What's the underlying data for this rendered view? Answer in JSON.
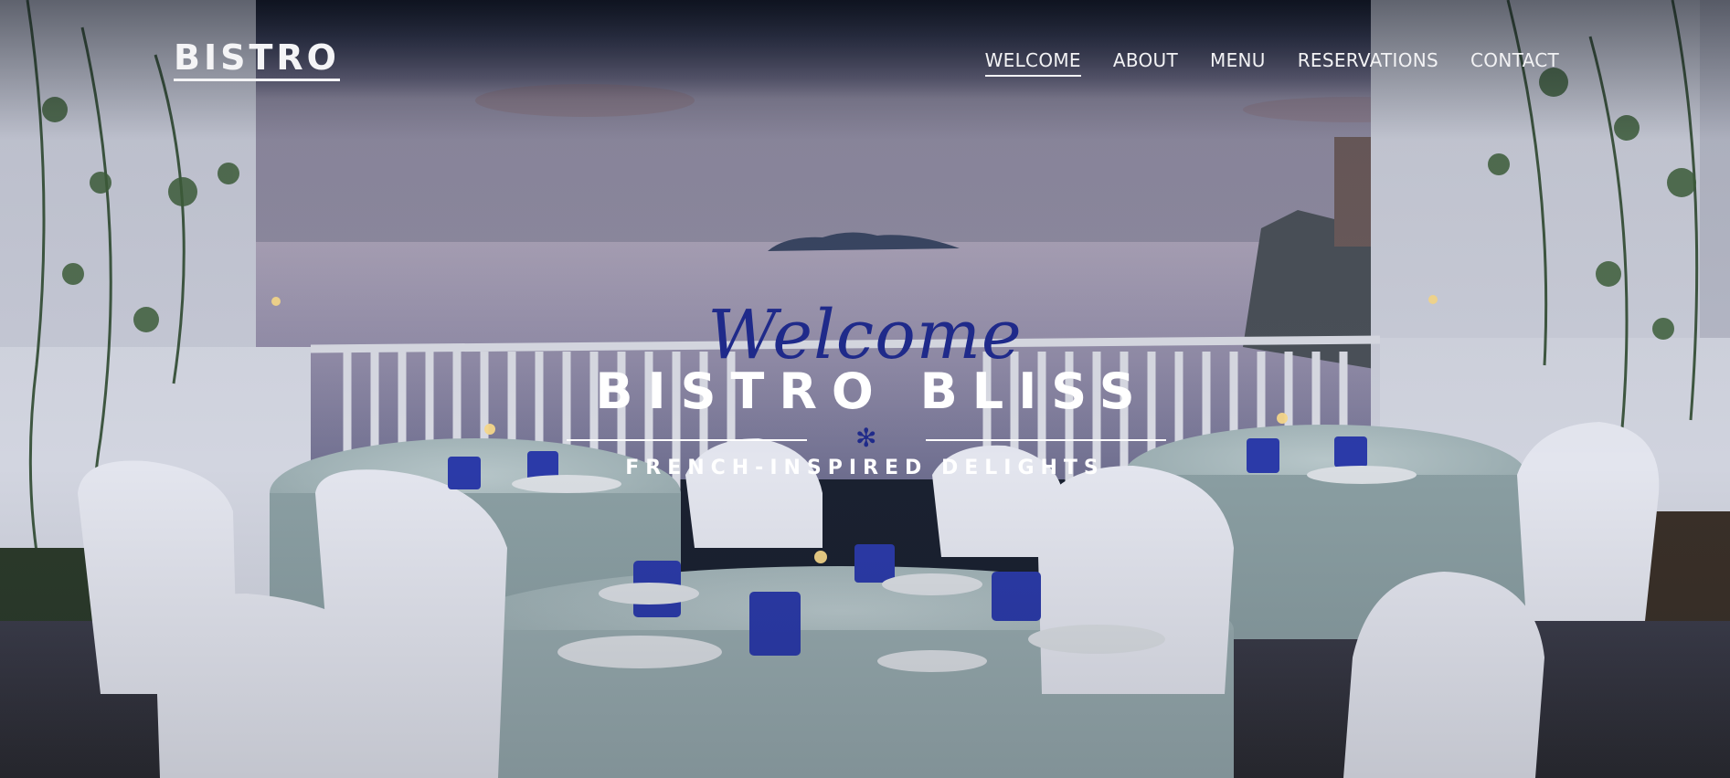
{
  "brand": {
    "logo": "BISTRO"
  },
  "nav": {
    "items": [
      {
        "label": "WELCOME",
        "active": true
      },
      {
        "label": "ABOUT",
        "active": false
      },
      {
        "label": "MENU",
        "active": false
      },
      {
        "label": "RESERVATIONS",
        "active": false
      },
      {
        "label": "CONTACT",
        "active": false
      }
    ]
  },
  "hero": {
    "script_heading": "Welcome",
    "title": "BISTRO BLISS",
    "divider_icon": "asterisk-icon",
    "tagline": "FRENCH-INSPIRED DELIGHTS"
  },
  "colors": {
    "accent": "#1f2a8a",
    "text": "#ffffff",
    "overlay": "#0a0e18"
  }
}
